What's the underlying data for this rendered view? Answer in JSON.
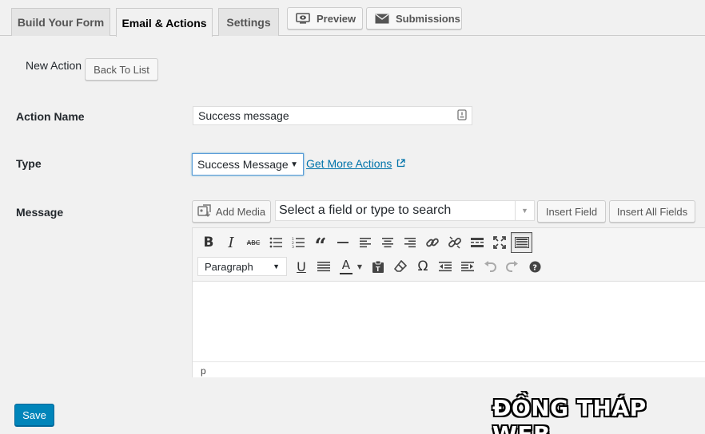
{
  "tabs": [
    {
      "label": "Build Your Form",
      "active": false
    },
    {
      "label": "Email & Actions",
      "active": true
    },
    {
      "label": "Settings",
      "active": false
    }
  ],
  "tab_buttons": {
    "preview": "Preview",
    "submissions": "Submissions"
  },
  "header": {
    "title": "New Action",
    "back_button": "Back To List"
  },
  "fields": {
    "action_name": {
      "label": "Action Name",
      "value": "Success message"
    },
    "type": {
      "label": "Type",
      "value": "Success Message",
      "more_link": "Get More Actions"
    },
    "message": {
      "label": "Message",
      "add_media": "Add Media",
      "field_search_placeholder": "Select a field or type to search",
      "insert_field": "Insert Field",
      "insert_all_fields": "Insert All Fields"
    }
  },
  "editor": {
    "format_select": "Paragraph",
    "status_path": "p"
  },
  "save_button": "Save",
  "watermark": "ĐỒNG THÁP WEB",
  "colors": {
    "primary": "#0085ba",
    "link": "#0073aa",
    "background": "#f1f1f1"
  }
}
